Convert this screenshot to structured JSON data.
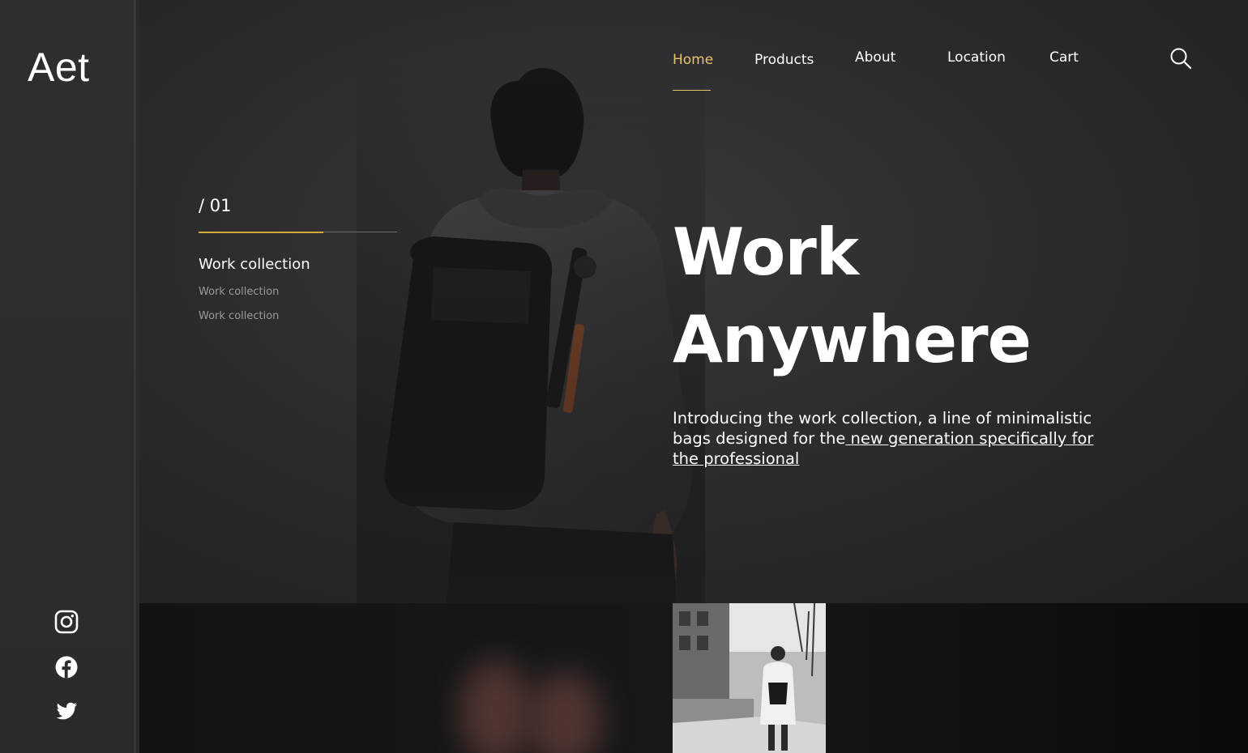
{
  "brand": {
    "logo_text": "Aet"
  },
  "nav": {
    "items": [
      {
        "label": "Home",
        "active": true
      },
      {
        "label": "Products",
        "active": false
      },
      {
        "label": "About",
        "active": false
      },
      {
        "label": "Location",
        "active": false
      },
      {
        "label": "Cart",
        "active": false
      }
    ],
    "search_icon": "search-icon",
    "active_color": "#e8c16a"
  },
  "slider": {
    "index_label": "/ 01",
    "progress": 0.63,
    "collections": [
      "Work collection",
      "Work collection",
      "Work collection"
    ]
  },
  "hero": {
    "headline_line1": "Work",
    "headline_line2": "Anywhere",
    "intro_text": "Introducing the work collection, a line of minimalistic bags designed for the",
    "intro_link": " new generation specifically for the professional"
  },
  "social": {
    "icons": [
      "instagram-icon",
      "facebook-icon",
      "twitter-icon"
    ]
  },
  "colors": {
    "accent": "#d4a93a",
    "background": "#2b2b2d",
    "text": "#ffffff",
    "muted_text": "#9a9a9c"
  }
}
